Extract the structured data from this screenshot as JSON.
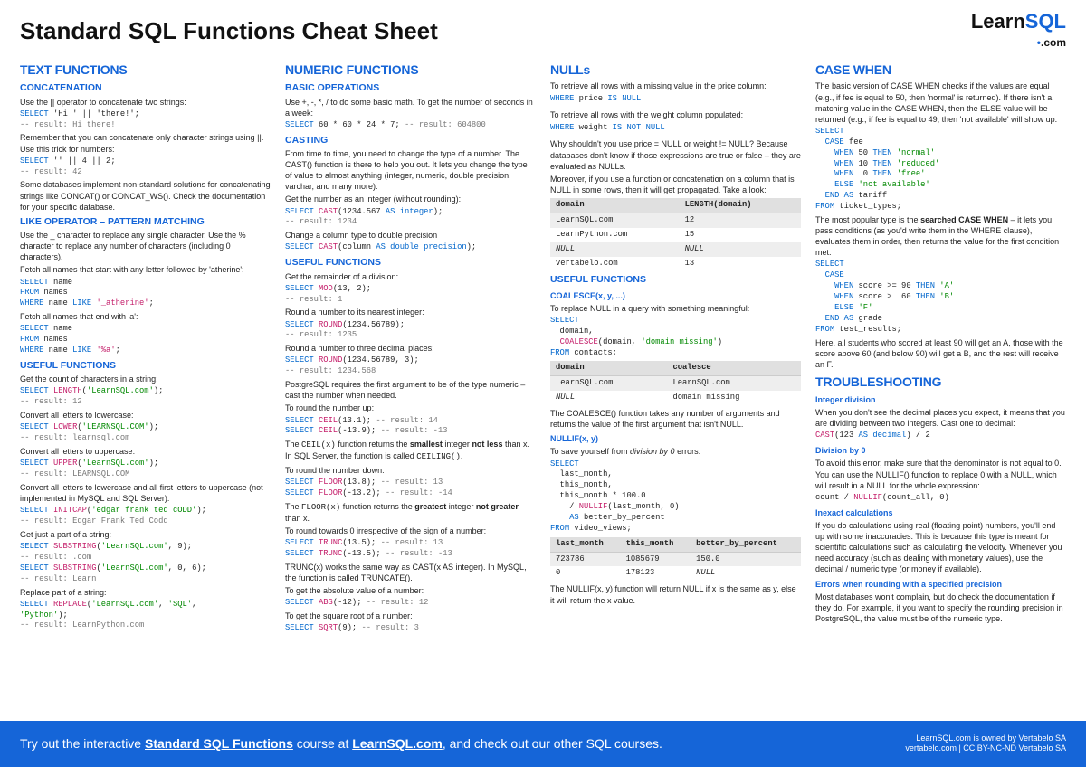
{
  "header": {
    "title": "Standard SQL Functions Cheat Sheet",
    "logo1": "Learn",
    "logo2": "SQL",
    "logo3": ".com"
  },
  "c1": {
    "h2": "TEXT FUNCTIONS",
    "concat_h": "CONCATENATION",
    "concat_p1": "Use the || operator to concatenate two strings:",
    "concat_c1a": "SELECT",
    "concat_c1b": " 'Hi ' || 'there!';",
    "concat_c1c": "-- result: Hi there!",
    "concat_p2": "Remember that you can concatenate only character strings using ||. Use this trick for numbers:",
    "concat_c2a": "SELECT",
    "concat_c2b": " '' || 4 || 2;",
    "concat_c2c": "-- result: 42",
    "concat_p3": "Some databases implement non-standard solutions for concatenating strings like CONCAT() or CONCAT_WS(). Check the documentation for your specific database.",
    "like_h": "LIKE OPERATOR – PATTERN MATCHING",
    "like_p1": "Use the _ character to replace any single character. Use the % character to replace any number of characters (including 0 characters).",
    "like_p2": "Fetch all names that start with any letter followed by 'atherine':",
    "like_c1": "SELECT name\nFROM names\nWHERE name LIKE '_atherine';",
    "like_p3": "Fetch all names that end with 'a':",
    "like_c2": "SELECT name\nFROM names\nWHERE name LIKE '%a';",
    "useful_h": "USEFUL FUNCTIONS",
    "uf_p1": "Get the count of characters in a string:",
    "uf_c1": "SELECT LENGTH('LearnSQL.com');\n-- result: 12",
    "uf_p2": "Convert all letters to lowercase:",
    "uf_c2": "SELECT LOWER('LEARNSQL.COM');\n-- result: learnsql.com",
    "uf_p3": "Convert all letters to uppercase:",
    "uf_c3": "SELECT UPPER('LearnSQL.com');\n-- result: LEARNSQL.COM",
    "uf_p4": "Convert all letters to lowercase and all first letters to uppercase (not implemented in MySQL and SQL Server):",
    "uf_c4": "SELECT INITCAP('edgar frank ted cODD');\n-- result: Edgar Frank Ted Codd",
    "uf_p5": "Get just a part of a string:",
    "uf_c5": "SELECT SUBSTRING('LearnSQL.com', 9);\n-- result: .com\nSELECT SUBSTRING('LearnSQL.com', 0, 6);\n-- result: Learn",
    "uf_p6": "Replace part of a string:",
    "uf_c6": "SELECT REPLACE('LearnSQL.com', 'SQL',\n'Python');\n-- result: LearnPython.com"
  },
  "c2": {
    "h2": "NUMERIC FUNCTIONS",
    "bo_h": "BASIC OPERATIONS",
    "bo_p1": "Use +, -, *, / to do some basic math. To get the number of seconds in a week:",
    "bo_c1": "SELECT 60 * 60 * 24 * 7; -- result: 604800",
    "cast_h": "CASTING",
    "cast_p1": "From time to time, you need to change the type of a number. The CAST() function is there to help you out. It lets you change the type of value to almost anything (integer, numeric, double precision, varchar, and many more).",
    "cast_p2": "Get the number as an integer (without rounding):",
    "cast_c1": "SELECT CAST(1234.567 AS integer);\n-- result: 1234",
    "cast_p3": "Change a column type to double precision",
    "cast_c2": "SELECT CAST(column AS double precision);",
    "uf_h": "USEFUL FUNCTIONS",
    "uf_p1": "Get the remainder of a division:",
    "uf_c1": "SELECT MOD(13, 2);\n-- result: 1",
    "uf_p2": "Round a number to its nearest integer:",
    "uf_c2": "SELECT ROUND(1234.56789);\n-- result: 1235",
    "uf_p3": "Round a number to three decimal places:",
    "uf_c3": "SELECT ROUND(1234.56789, 3);\n-- result: 1234.568",
    "uf_p4": "PostgreSQL requires the first argument to be of the type numeric – cast the number when needed.",
    "uf_p5": "To round the number up:",
    "uf_c5": "SELECT CEIL(13.1); -- result: 14\nSELECT CEIL(-13.9); -- result: -13",
    "uf_p5b": "The CEIL(x) function returns the smallest integer not less than x. In SQL Server, the function is called CEILING().",
    "uf_p6": "To round the number down:",
    "uf_c6": "SELECT FLOOR(13.8); -- result: 13\nSELECT FLOOR(-13.2); -- result: -14",
    "uf_p6b": "The FLOOR(x) function returns the greatest integer not greater than x.",
    "uf_p7": "To round towards 0 irrespective of the sign of a number:",
    "uf_c7": "SELECT TRUNC(13.5); -- result: 13\nSELECT TRUNC(-13.5); -- result: -13",
    "uf_p7b": "TRUNC(x) works the same way as CAST(x AS integer). In MySQL, the function is called TRUNCATE().",
    "uf_p8": "To get the absolute value of a number:",
    "uf_c8": "SELECT ABS(-12); -- result: 12",
    "uf_p9": "To get the square root of a number:",
    "uf_c9": "SELECT SQRT(9); -- result: 3"
  },
  "c3": {
    "h2": "NULLs",
    "n_p1": "To retrieve all rows with a missing value in the price column:",
    "n_c1": "WHERE price IS NULL",
    "n_p2": "To retrieve all rows with the weight column populated:",
    "n_c2": "WHERE weight IS NOT NULL",
    "n_p3": "Why shouldn't you use price = NULL or weight != NULL? Because databases don't know if those expressions are true or false – they are evaluated as NULLs.",
    "n_p4": "Moreover, if you use a function or concatenation on a column that is NULL in some rows, then it will get propagated. Take a look:",
    "tbl1": {
      "h1": "domain",
      "h2": "LENGTH(domain)",
      "rows": [
        [
          "LearnSQL.com",
          "12"
        ],
        [
          "LearnPython.com",
          "15"
        ],
        [
          "NULL",
          "NULL"
        ],
        [
          "vertabelo.com",
          "13"
        ]
      ]
    },
    "uf_h": "USEFUL FUNCTIONS",
    "co_h": "COALESCE(x, y, ...)",
    "co_p1": "To replace NULL in a query with something meaningful:",
    "co_c1": "SELECT\n  domain,\n  COALESCE(domain, 'domain missing')\nFROM contacts;",
    "tbl2": {
      "h1": "domain",
      "h2": "coalesce",
      "rows": [
        [
          "LearnSQL.com",
          "LearnSQL.com"
        ],
        [
          "NULL",
          "domain missing"
        ]
      ]
    },
    "co_p2": "The COALESCE() function takes any number of arguments and returns the value of the first argument that isn't NULL.",
    "nif_h": "NULLIF(x, y)",
    "nif_p1": "To save yourself from division by 0 errors:",
    "nif_c1": "SELECT\n  last_month,\n  this_month,\n  this_month * 100.0\n    / NULLIF(last_month, 0)\n    AS better_by_percent\nFROM video_views;",
    "tbl3": {
      "h1": "last_month",
      "h2": "this_month",
      "h3": "better_by_percent",
      "rows": [
        [
          "723786",
          "1085679",
          "150.0"
        ],
        [
          "0",
          "178123",
          "NULL"
        ]
      ]
    },
    "nif_p2": "The NULLIF(x, y) function will return NULL if x is the same as y, else it will return the x value."
  },
  "c4": {
    "h2": "CASE WHEN",
    "cw_p1": "The basic version of CASE WHEN checks if the values are equal (e.g., if fee is equal to 50, then 'normal' is returned). If there isn't a matching value in the CASE WHEN, then the ELSE value will be returned (e.g., if fee is equal to 49, then 'not available' will show up.",
    "cw_c1": "SELECT\n  CASE fee\n    WHEN 50 THEN 'normal'\n    WHEN 10 THEN 'reduced'\n    WHEN  0 THEN 'free'\n    ELSE 'not available'\n  END AS tariff\nFROM ticket_types;",
    "cw_p2": "The most popular type is the searched CASE WHEN – it lets you pass conditions (as you'd write them in the WHERE clause), evaluates them in order, then returns the value for the first condition met.",
    "cw_c2": "SELECT\n  CASE\n    WHEN score >= 90 THEN 'A'\n    WHEN score >  60 THEN 'B'\n    ELSE 'F'\n  END AS grade\nFROM test_results;",
    "cw_p3": "Here, all students who scored at least 90 will get an A, those with the score above 60 (and below 90) will get a B, and the rest will receive an F.",
    "tr_h": "TROUBLESHOOTING",
    "tr1_h": "Integer division",
    "tr1_p": "When you don't see the decimal places you expect, it means that you are dividing between two integers. Cast one to decimal:",
    "tr1_c": "CAST(123 AS decimal) / 2",
    "tr2_h": "Division by 0",
    "tr2_p": "To avoid this error, make sure that the denominator is not equal to 0. You can use the NULLIF() function to replace 0 with a NULL, which will result in a NULL for the whole expression:",
    "tr2_c": "count / NULLIF(count_all, 0)",
    "tr3_h": "Inexact calculations",
    "tr3_p": "If you do calculations using real (floating point) numbers, you'll end up with some inaccuracies. This is because this type is meant for scientific calculations such as calculating the velocity. Whenever you need accuracy (such as dealing with monetary values), use the decimal / numeric type (or money if available).",
    "tr4_h": "Errors when rounding with a specified precision",
    "tr4_p": "Most databases won't complain, but do check the documentation if they do. For example, if you want to specify the rounding precision in PostgreSQL, the value must be of the numeric type."
  },
  "footer": {
    "cta1": "Try out the interactive ",
    "cta2": "Standard SQL Functions",
    "cta3": " course at ",
    "cta4": "LearnSQL.com",
    "cta5": ", and check out our other SQL courses.",
    "cr1": "LearnSQL.com is owned by Vertabelo SA",
    "cr2": "vertabelo.com | CC BY-NC-ND Vertabelo SA"
  }
}
